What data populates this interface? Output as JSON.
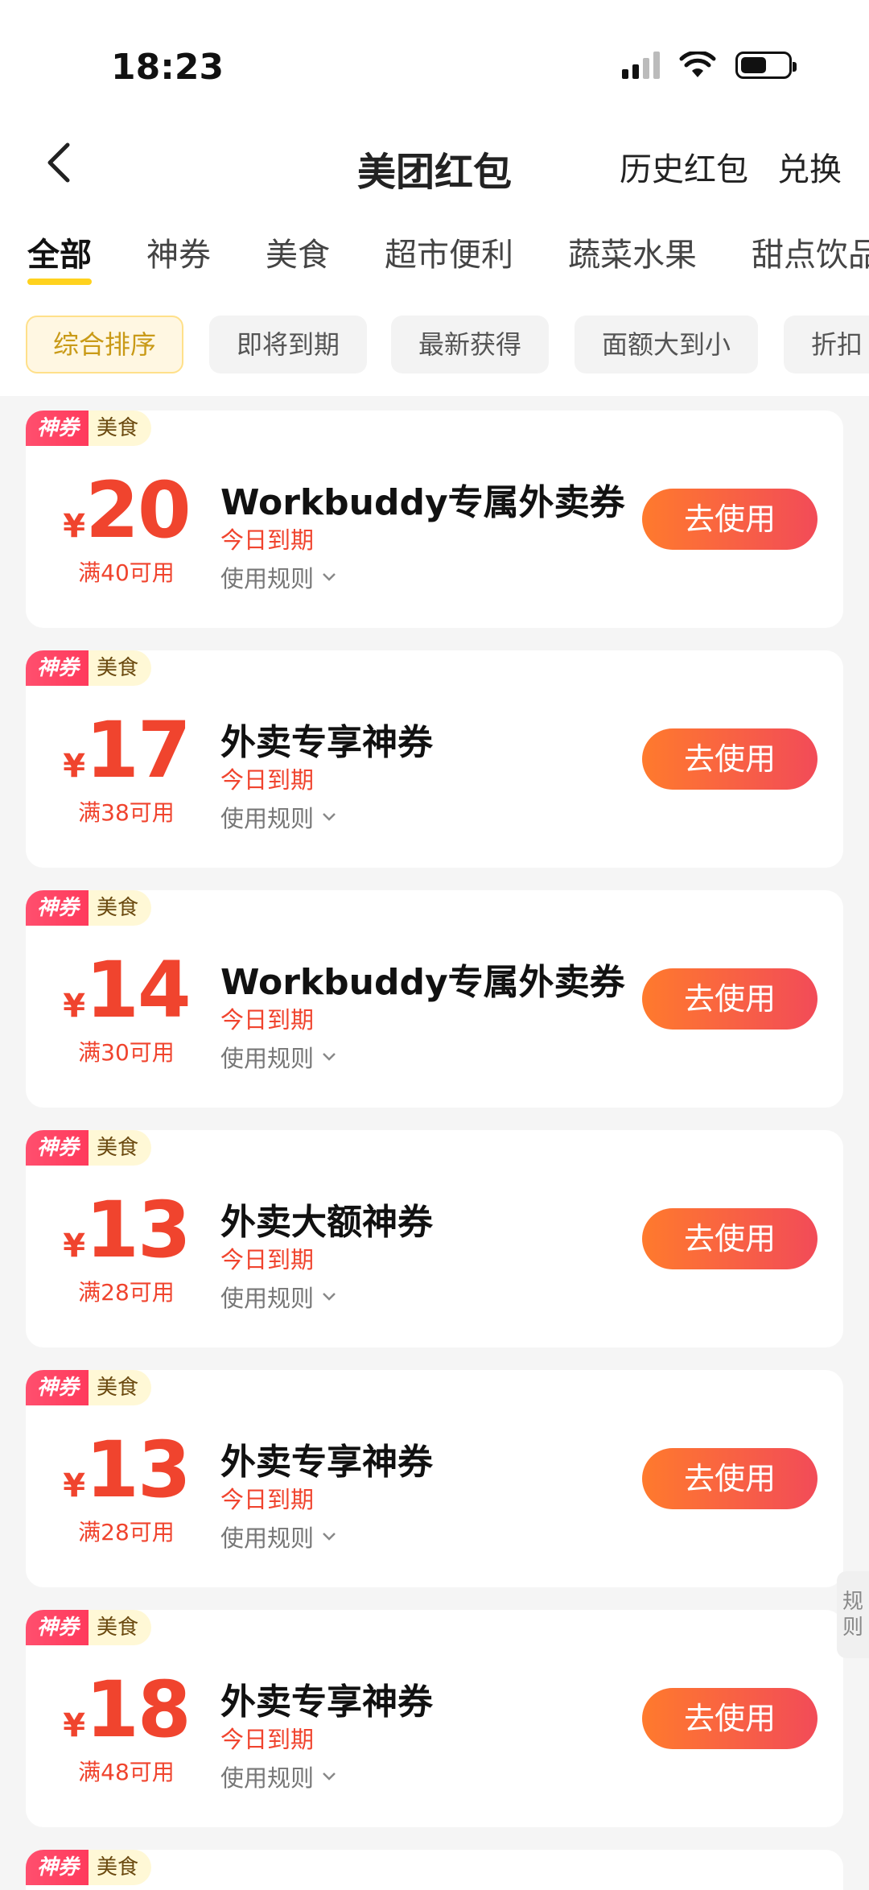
{
  "status_bar": {
    "time": "18:23"
  },
  "nav": {
    "title": "美团红包",
    "history": "历史红包",
    "exchange": "兑换"
  },
  "categories": [
    "全部",
    "神券",
    "美食",
    "超市便利",
    "蔬菜水果",
    "甜点饮品"
  ],
  "active_category": "全部",
  "filters": [
    "综合排序",
    "即将到期",
    "最新获得",
    "面额大到小",
    "折扣"
  ],
  "active_filter": "综合排序",
  "coupons": [
    {
      "badge": "神券",
      "category": "美食",
      "currency": "¥",
      "amount": "20",
      "threshold": "满40可用",
      "title": "Workbuddy专属外卖券",
      "expire": "今日到期",
      "rules": "使用规则",
      "button": "去使用"
    },
    {
      "badge": "神券",
      "category": "美食",
      "currency": "¥",
      "amount": "17",
      "threshold": "满38可用",
      "title": "外卖专享神券",
      "expire": "今日到期",
      "rules": "使用规则",
      "button": "去使用"
    },
    {
      "badge": "神券",
      "category": "美食",
      "currency": "¥",
      "amount": "14",
      "threshold": "满30可用",
      "title": "Workbuddy专属外卖券",
      "expire": "今日到期",
      "rules": "使用规则",
      "button": "去使用"
    },
    {
      "badge": "神券",
      "category": "美食",
      "currency": "¥",
      "amount": "13",
      "threshold": "满28可用",
      "title": "外卖大额神券",
      "expire": "今日到期",
      "rules": "使用规则",
      "button": "去使用"
    },
    {
      "badge": "神券",
      "category": "美食",
      "currency": "¥",
      "amount": "13",
      "threshold": "满28可用",
      "title": "外卖专享神券",
      "expire": "今日到期",
      "rules": "使用规则",
      "button": "去使用"
    },
    {
      "badge": "神券",
      "category": "美食",
      "currency": "¥",
      "amount": "18",
      "threshold": "满48可用",
      "title": "外卖专享神券",
      "expire": "今日到期",
      "rules": "使用规则",
      "button": "去使用"
    },
    {
      "badge": "神券",
      "category": "美食"
    }
  ],
  "side_rule": "规则",
  "colors": {
    "accent_yellow": "#ffd21e",
    "price_red": "#f0442e",
    "button_start": "#ff7a2d",
    "button_end": "#f24b58"
  }
}
